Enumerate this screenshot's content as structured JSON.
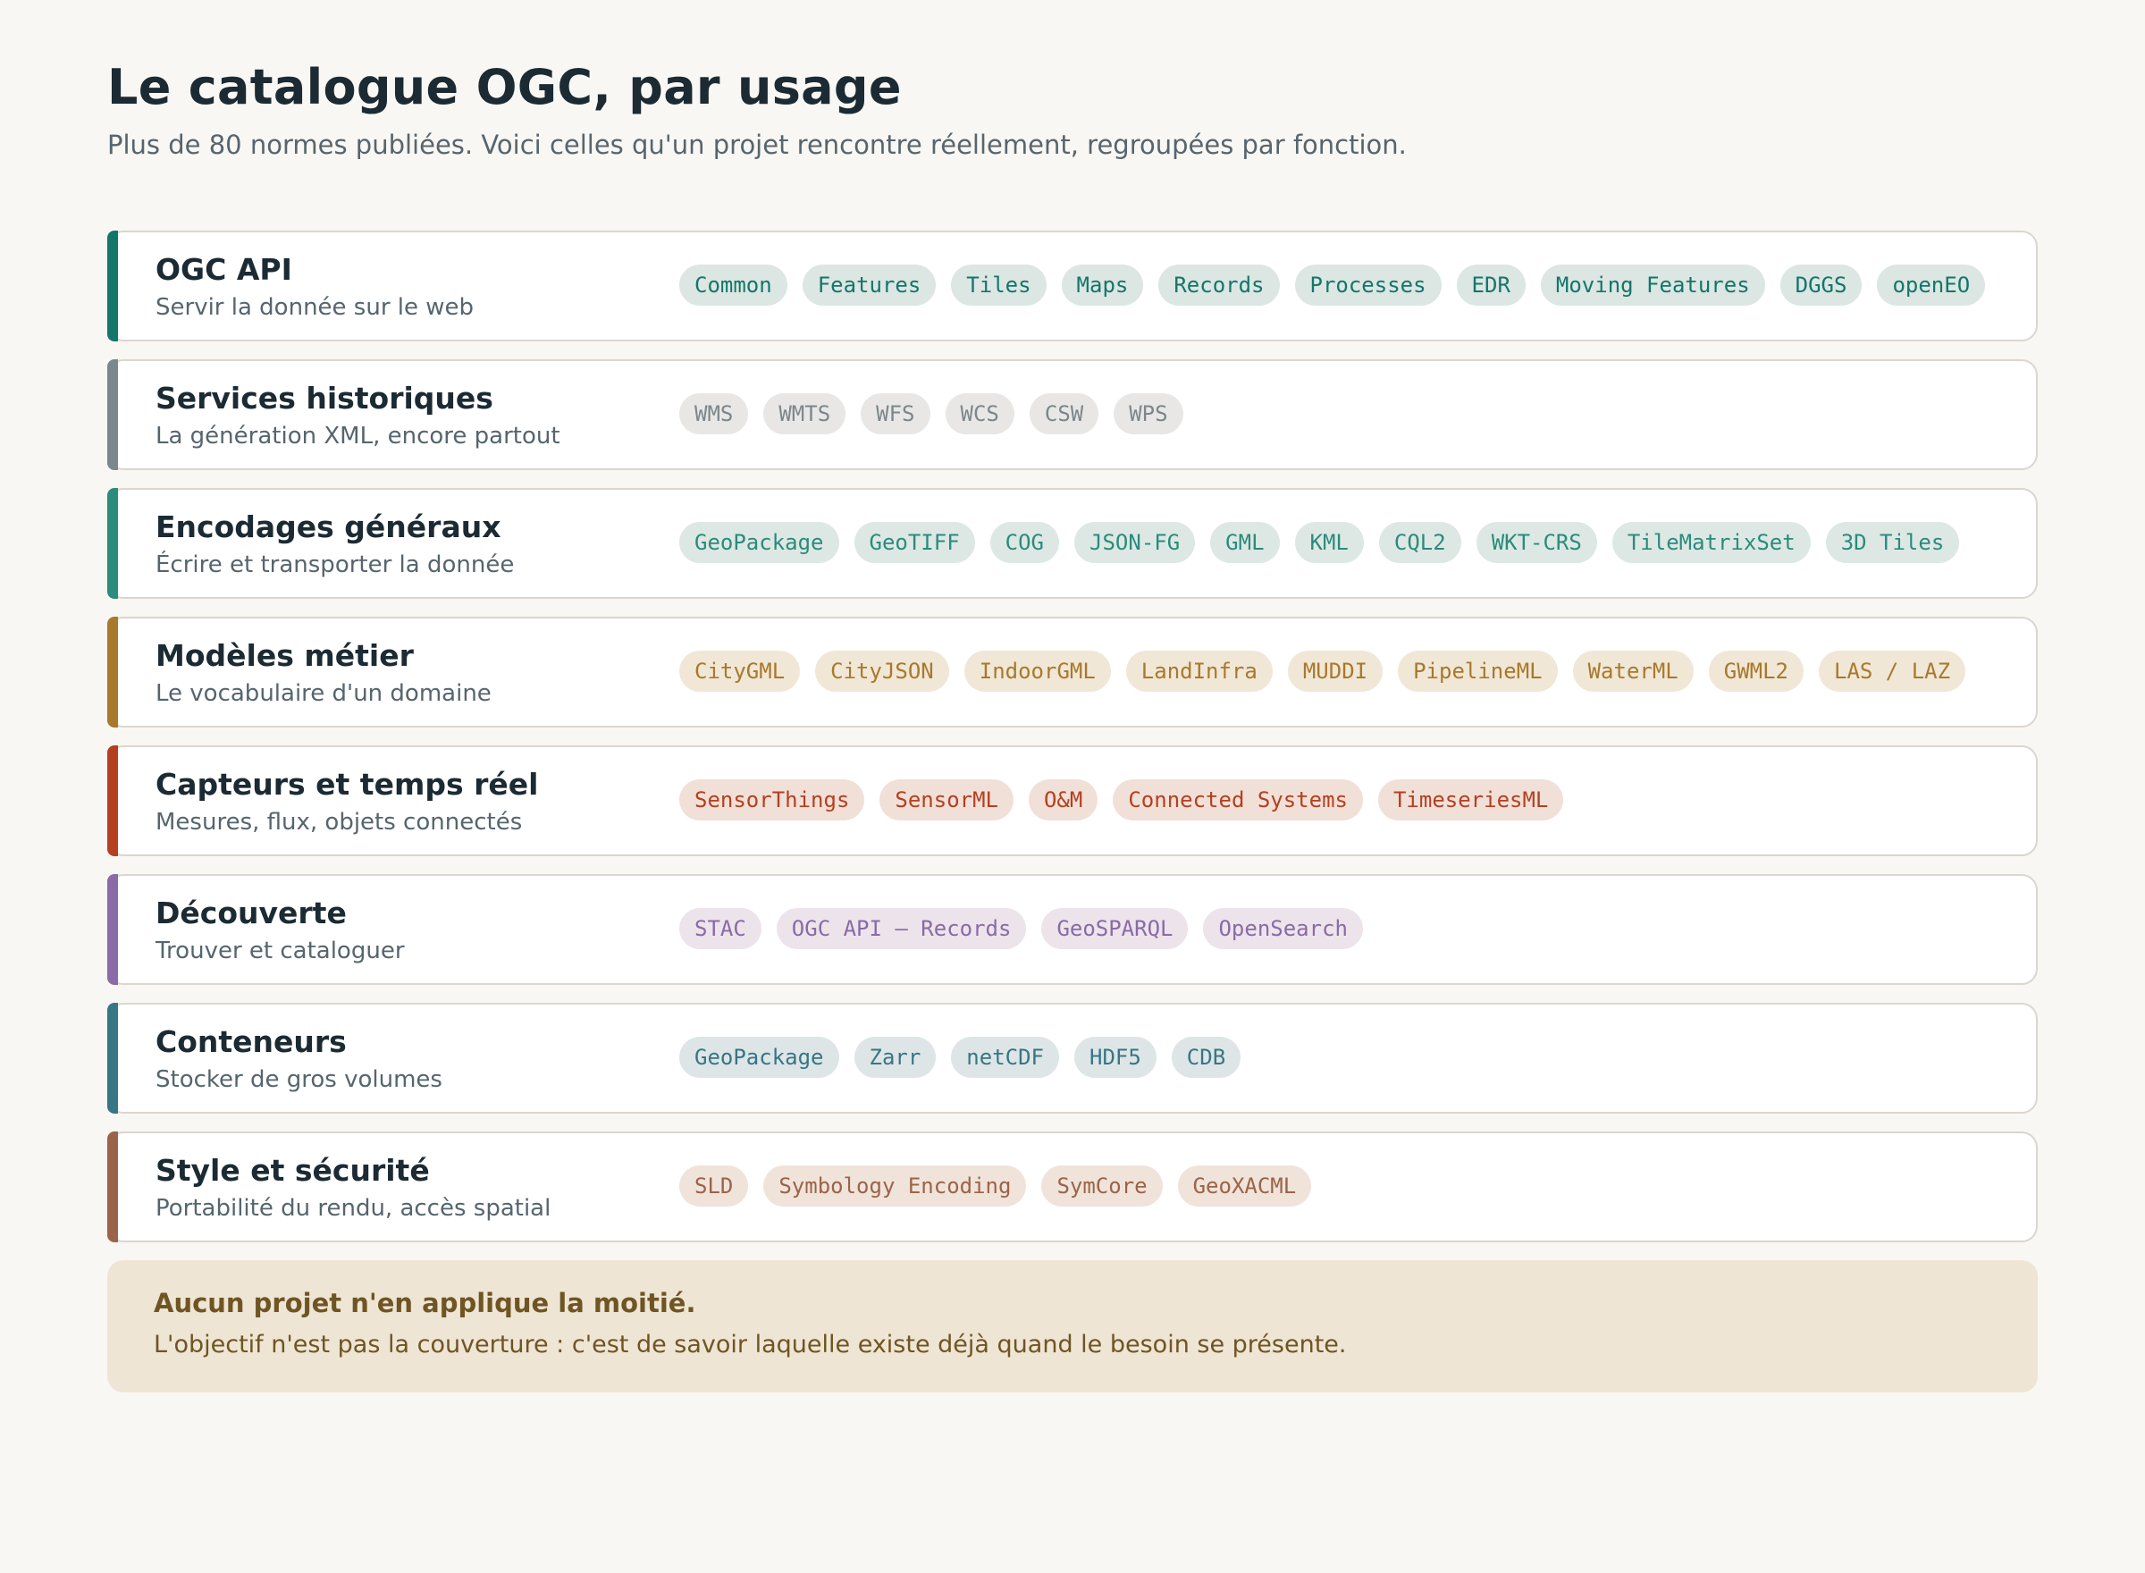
{
  "header": {
    "title": "Le catalogue OGC, par usage",
    "subtitle": "Plus de 80 normes publiées. Voici celles qu'un projet rencontre réellement, regroupées par fonction."
  },
  "categories": [
    {
      "id": "ogc-api",
      "name": "OGC API",
      "description": "Servir la donnée sur le web",
      "accent": "#13766b",
      "tag_bg": "#dce6e2",
      "tag_fg": "#13766b",
      "tags": [
        "Common",
        "Features",
        "Tiles",
        "Maps",
        "Records",
        "Processes",
        "EDR",
        "Moving Features",
        "DGGS",
        "openEO"
      ]
    },
    {
      "id": "services-historiques",
      "name": "Services historiques",
      "description": "La génération XML, encore partout",
      "accent": "#7a878c",
      "tag_bg": "#e8e7e5",
      "tag_fg": "#7c878c",
      "tags": [
        "WMS",
        "WMTS",
        "WFS",
        "WCS",
        "CSW",
        "WPS"
      ]
    },
    {
      "id": "encodages-generaux",
      "name": "Encodages généraux",
      "description": "Écrire et transporter la donnée",
      "accent": "#2b8b7c",
      "tag_bg": "#dde8e4",
      "tag_fg": "#2b8b7c",
      "tags": [
        "GeoPackage",
        "GeoTIFF",
        "COG",
        "JSON-FG",
        "GML",
        "KML",
        "CQL2",
        "WKT-CRS",
        "TileMatrixSet",
        "3D Tiles"
      ]
    },
    {
      "id": "modeles-metier",
      "name": "Modèles métier",
      "description": "Le vocabulaire d'un domaine",
      "accent": "#a8792c",
      "tag_bg": "#f1e7d6",
      "tag_fg": "#a8792c",
      "tags": [
        "CityGML",
        "CityJSON",
        "IndoorGML",
        "LandInfra",
        "MUDDI",
        "PipelineML",
        "WaterML",
        "GWML2",
        "LAS / LAZ"
      ]
    },
    {
      "id": "capteurs",
      "name": "Capteurs et temps réel",
      "description": "Mesures, flux, objets connectés",
      "accent": "#b5401f",
      "tag_bg": "#f1e0d8",
      "tag_fg": "#b5401f",
      "tags": [
        "SensorThings",
        "SensorML",
        "O&M",
        "Connected Systems",
        "TimeseriesML"
      ]
    },
    {
      "id": "decouverte",
      "name": "Découverte",
      "description": "Trouver et cataloguer",
      "accent": "#8a6aa8",
      "tag_bg": "#ece4ea",
      "tag_fg": "#8a6aa8",
      "tags": [
        "STAC",
        "OGC API — Records",
        "GeoSPARQL",
        "OpenSearch"
      ]
    },
    {
      "id": "conteneurs",
      "name": "Conteneurs",
      "description": "Stocker de gros volumes",
      "accent": "#377685",
      "tag_bg": "#dee5e6",
      "tag_fg": "#377685",
      "tags": [
        "GeoPackage",
        "Zarr",
        "netCDF",
        "HDF5",
        "CDB"
      ]
    },
    {
      "id": "style-securite",
      "name": "Style et sécurité",
      "description": "Portabilité du rendu, accès spatial",
      "accent": "#9b6448",
      "tag_bg": "#f0e3da",
      "tag_fg": "#9b6448",
      "tags": [
        "SLD",
        "Symbology Encoding",
        "SymCore",
        "GeoXACML"
      ]
    }
  ],
  "note": {
    "title": "Aucun projet n'en applique la moitié.",
    "text": "L'objectif n'est pas la couverture : c'est de savoir laquelle existe déjà quand le besoin se présente."
  }
}
